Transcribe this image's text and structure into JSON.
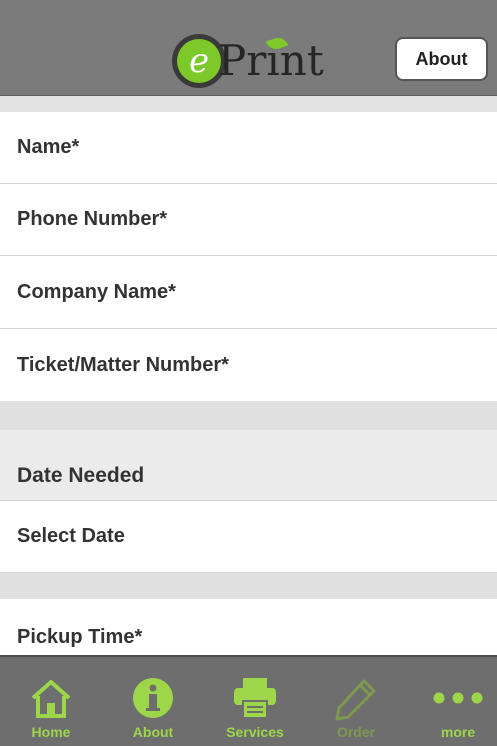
{
  "header": {
    "logo_e": "e",
    "logo_text": "Print",
    "about_button": "About"
  },
  "form": {
    "fields": [
      {
        "label": "Name*"
      },
      {
        "label": "Phone Number*"
      },
      {
        "label": "Company Name*"
      },
      {
        "label": "Ticket/Matter Number*"
      }
    ],
    "date_section": {
      "header": "Date Needed",
      "select_label": "Select Date"
    },
    "pickup_label": "Pickup Time*"
  },
  "tabbar": {
    "tabs": [
      {
        "label": "Home",
        "icon": "home-icon"
      },
      {
        "label": "About",
        "icon": "info-icon"
      },
      {
        "label": "Services",
        "icon": "printer-icon"
      },
      {
        "label": "Order",
        "icon": "pencil-icon"
      },
      {
        "label": "more",
        "icon": "more-dots-icon"
      }
    ]
  },
  "colors": {
    "accent": "#9ed64a",
    "topbar": "#7b7b7b",
    "tabbar": "#6e6e6e"
  }
}
